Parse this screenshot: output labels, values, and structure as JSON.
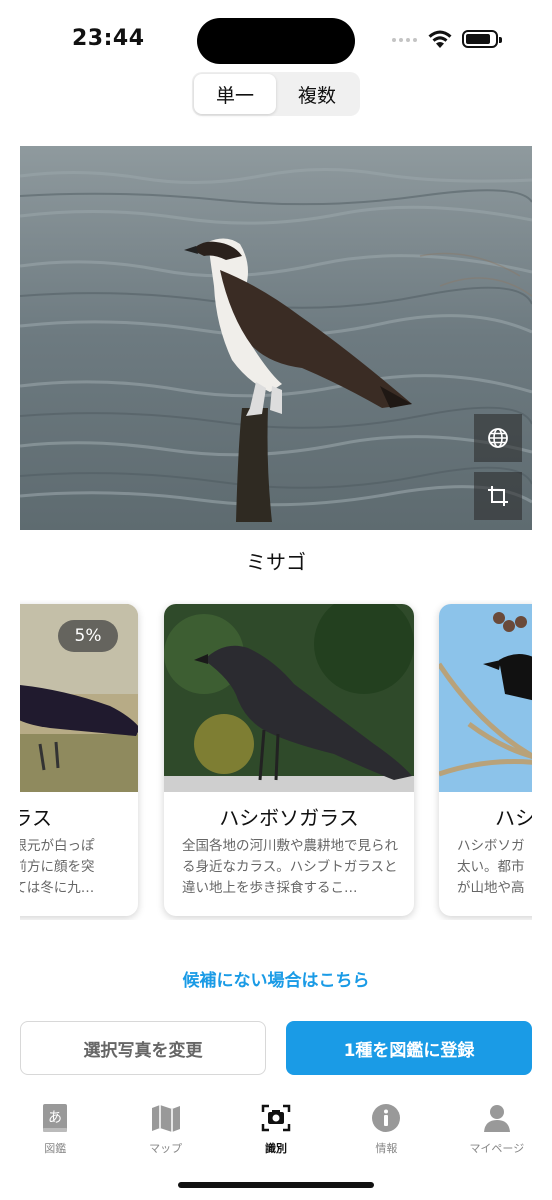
{
  "status": {
    "time": "23:44"
  },
  "segmented": {
    "single": "単一",
    "multiple": "複数"
  },
  "species": {
    "name": "ミサゴ"
  },
  "candidates": [
    {
      "title": "ガラス",
      "badge": "5%",
      "desc": "の根元が白っぽ\nは前方に顔を突\nつては冬に九…"
    },
    {
      "title": "ハシボソガラス",
      "desc": "全国各地の河川敷や農耕地で見られる身近なカラス。ハシブトガラスと違い地上を歩き採食するこ…"
    },
    {
      "title": "ハシ",
      "desc": "ハシボソガ\n太い。都市\nが山地や高"
    }
  ],
  "links": {
    "not_found": "候補にない場合はこちら"
  },
  "buttons": {
    "change_photo": "選択写真を変更",
    "register": "1種を図鑑に登録"
  },
  "tabs": [
    {
      "label": "図鑑",
      "icon": "book-icon"
    },
    {
      "label": "マップ",
      "icon": "map-icon"
    },
    {
      "label": "識別",
      "icon": "camera-scan-icon",
      "active": true
    },
    {
      "label": "情報",
      "icon": "info-icon"
    },
    {
      "label": "マイページ",
      "icon": "person-icon"
    }
  ],
  "colors": {
    "accent": "#1a9be6"
  }
}
